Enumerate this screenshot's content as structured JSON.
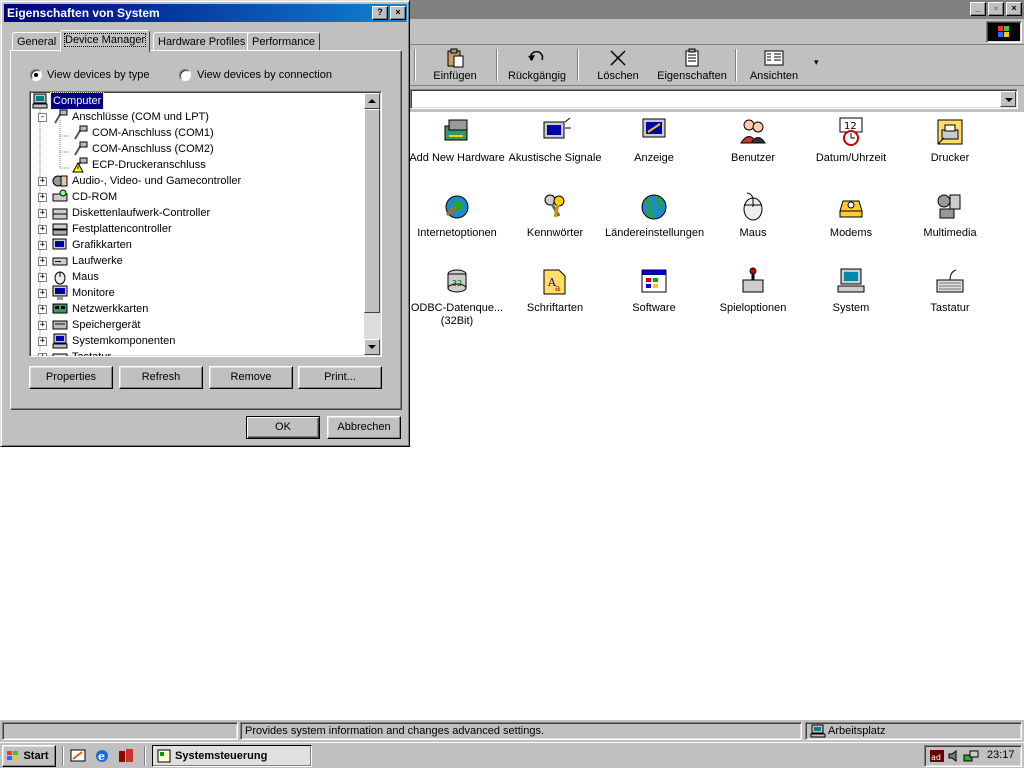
{
  "main_window": {
    "toolbar": [
      {
        "label": "Einfügen",
        "icon": "paste-icon"
      },
      {
        "label": "Rückgängig",
        "icon": "undo-icon"
      },
      {
        "label": "Löschen",
        "icon": "delete-icon"
      },
      {
        "label": "Eigenschaften",
        "icon": "properties-icon"
      },
      {
        "label": "Ansichten",
        "icon": "views-icon"
      }
    ],
    "control_panel_items": [
      {
        "label": "Add New Hardware",
        "icon": "add-hardware-icon"
      },
      {
        "label": "Akustische Signale",
        "icon": "sounds-icon"
      },
      {
        "label": "Anzeige",
        "icon": "display-icon"
      },
      {
        "label": "Benutzer",
        "icon": "users-icon"
      },
      {
        "label": "Datum/Uhrzeit",
        "icon": "date-time-icon"
      },
      {
        "label": "Drucker",
        "icon": "printers-icon"
      },
      {
        "label": "Internetoptionen",
        "icon": "internet-options-icon"
      },
      {
        "label": "Kennwörter",
        "icon": "passwords-icon"
      },
      {
        "label": "Ländereinstellungen",
        "icon": "regional-settings-icon"
      },
      {
        "label": "Maus",
        "icon": "mouse-icon"
      },
      {
        "label": "Modems",
        "icon": "modems-icon"
      },
      {
        "label": "Multimedia",
        "icon": "multimedia-icon"
      },
      {
        "label": "ODBC-Datenque... (32Bit)",
        "icon": "odbc-icon"
      },
      {
        "label": "Schriftarten",
        "icon": "fonts-icon"
      },
      {
        "label": "Software",
        "icon": "add-remove-programs-icon"
      },
      {
        "label": "Spieloptionen",
        "icon": "game-controllers-icon"
      },
      {
        "label": "System",
        "icon": "system-icon"
      },
      {
        "label": "Tastatur",
        "icon": "keyboard-icon"
      }
    ],
    "status": {
      "text": "Provides system information and changes advanced settings.",
      "location": "Arbeitsplatz"
    }
  },
  "dialog": {
    "title": "Eigenschaften von System",
    "help_button": "?",
    "close_button": "×",
    "tabs": [
      "General",
      "Device Manager",
      "Hardware Profiles",
      "Performance"
    ],
    "active_tab": "Device Manager",
    "radio_by_type": "View devices by type",
    "radio_by_connection": "View devices by connection",
    "tree": [
      {
        "label": "Computer",
        "level": 0,
        "expander": "",
        "icon": "computer-icon",
        "selected": true
      },
      {
        "label": "Anschlüsse (COM und LPT)",
        "level": 1,
        "expander": "-",
        "icon": "port-connector-icon"
      },
      {
        "label": "COM-Anschluss (COM1)",
        "level": 2,
        "expander": "",
        "icon": "port-connector-icon"
      },
      {
        "label": "COM-Anschluss (COM2)",
        "level": 2,
        "expander": "",
        "icon": "port-connector-icon"
      },
      {
        "label": "ECP-Druckeranschluss",
        "level": 2,
        "expander": "",
        "icon": "warning-port-icon"
      },
      {
        "label": "Audio-, Video- und Gamecontroller",
        "level": 1,
        "expander": "+",
        "icon": "audio-device-icon"
      },
      {
        "label": "CD-ROM",
        "level": 1,
        "expander": "+",
        "icon": "cdrom-icon"
      },
      {
        "label": "Diskettenlaufwerk-Controller",
        "level": 1,
        "expander": "+",
        "icon": "floppy-controller-icon"
      },
      {
        "label": "Festplattencontroller",
        "level": 1,
        "expander": "+",
        "icon": "disk-controller-icon"
      },
      {
        "label": "Grafikkarten",
        "level": 1,
        "expander": "+",
        "icon": "display-adapter-icon"
      },
      {
        "label": "Laufwerke",
        "level": 1,
        "expander": "+",
        "icon": "drive-icon"
      },
      {
        "label": "Maus",
        "level": 1,
        "expander": "+",
        "icon": "mouse-icon"
      },
      {
        "label": "Monitore",
        "level": 1,
        "expander": "+",
        "icon": "monitor-icon"
      },
      {
        "label": "Netzwerkkarten",
        "level": 1,
        "expander": "+",
        "icon": "network-card-icon"
      },
      {
        "label": "Speichergerät",
        "level": 1,
        "expander": "+",
        "icon": "storage-icon"
      },
      {
        "label": "Systemkomponenten",
        "level": 1,
        "expander": "+",
        "icon": "system-devices-icon"
      },
      {
        "label": "Tastatur",
        "level": 1,
        "expander": "+",
        "icon": "keyboard-icon"
      }
    ],
    "buttons": {
      "properties": "Properties",
      "refresh": "Refresh",
      "remove": "Remove",
      "print": "Print..."
    },
    "ok": "OK",
    "cancel": "Abbrechen"
  },
  "taskbar": {
    "start": "Start",
    "task": "Systemsteuerung",
    "clock": "23:17"
  },
  "colors": {
    "title_active": "#000080",
    "title_gradient_end": "#1084d0",
    "face": "#c0c0c0",
    "selection": "#000080"
  }
}
